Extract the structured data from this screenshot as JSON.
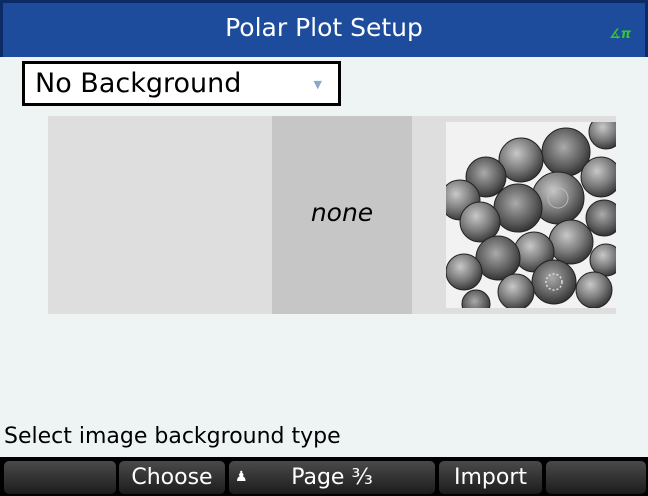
{
  "header": {
    "title": "Polar Plot Setup",
    "angle_mode": "∡π"
  },
  "background_type": {
    "selected": "No Background"
  },
  "background_options": {
    "none_label": "none",
    "image_icon": "coins-photo-icon"
  },
  "status": {
    "message": "Select image background type"
  },
  "softkeys": [
    {
      "label": ""
    },
    {
      "label": "Choose"
    },
    {
      "label": "Page ³⁄₃",
      "icon": "person-icon"
    },
    {
      "label": "Import"
    },
    {
      "label": ""
    }
  ],
  "colors": {
    "title_bar": "#1e4c9c",
    "screen_bg": "#eef4f4",
    "selected_option": "#c6c6c6"
  }
}
